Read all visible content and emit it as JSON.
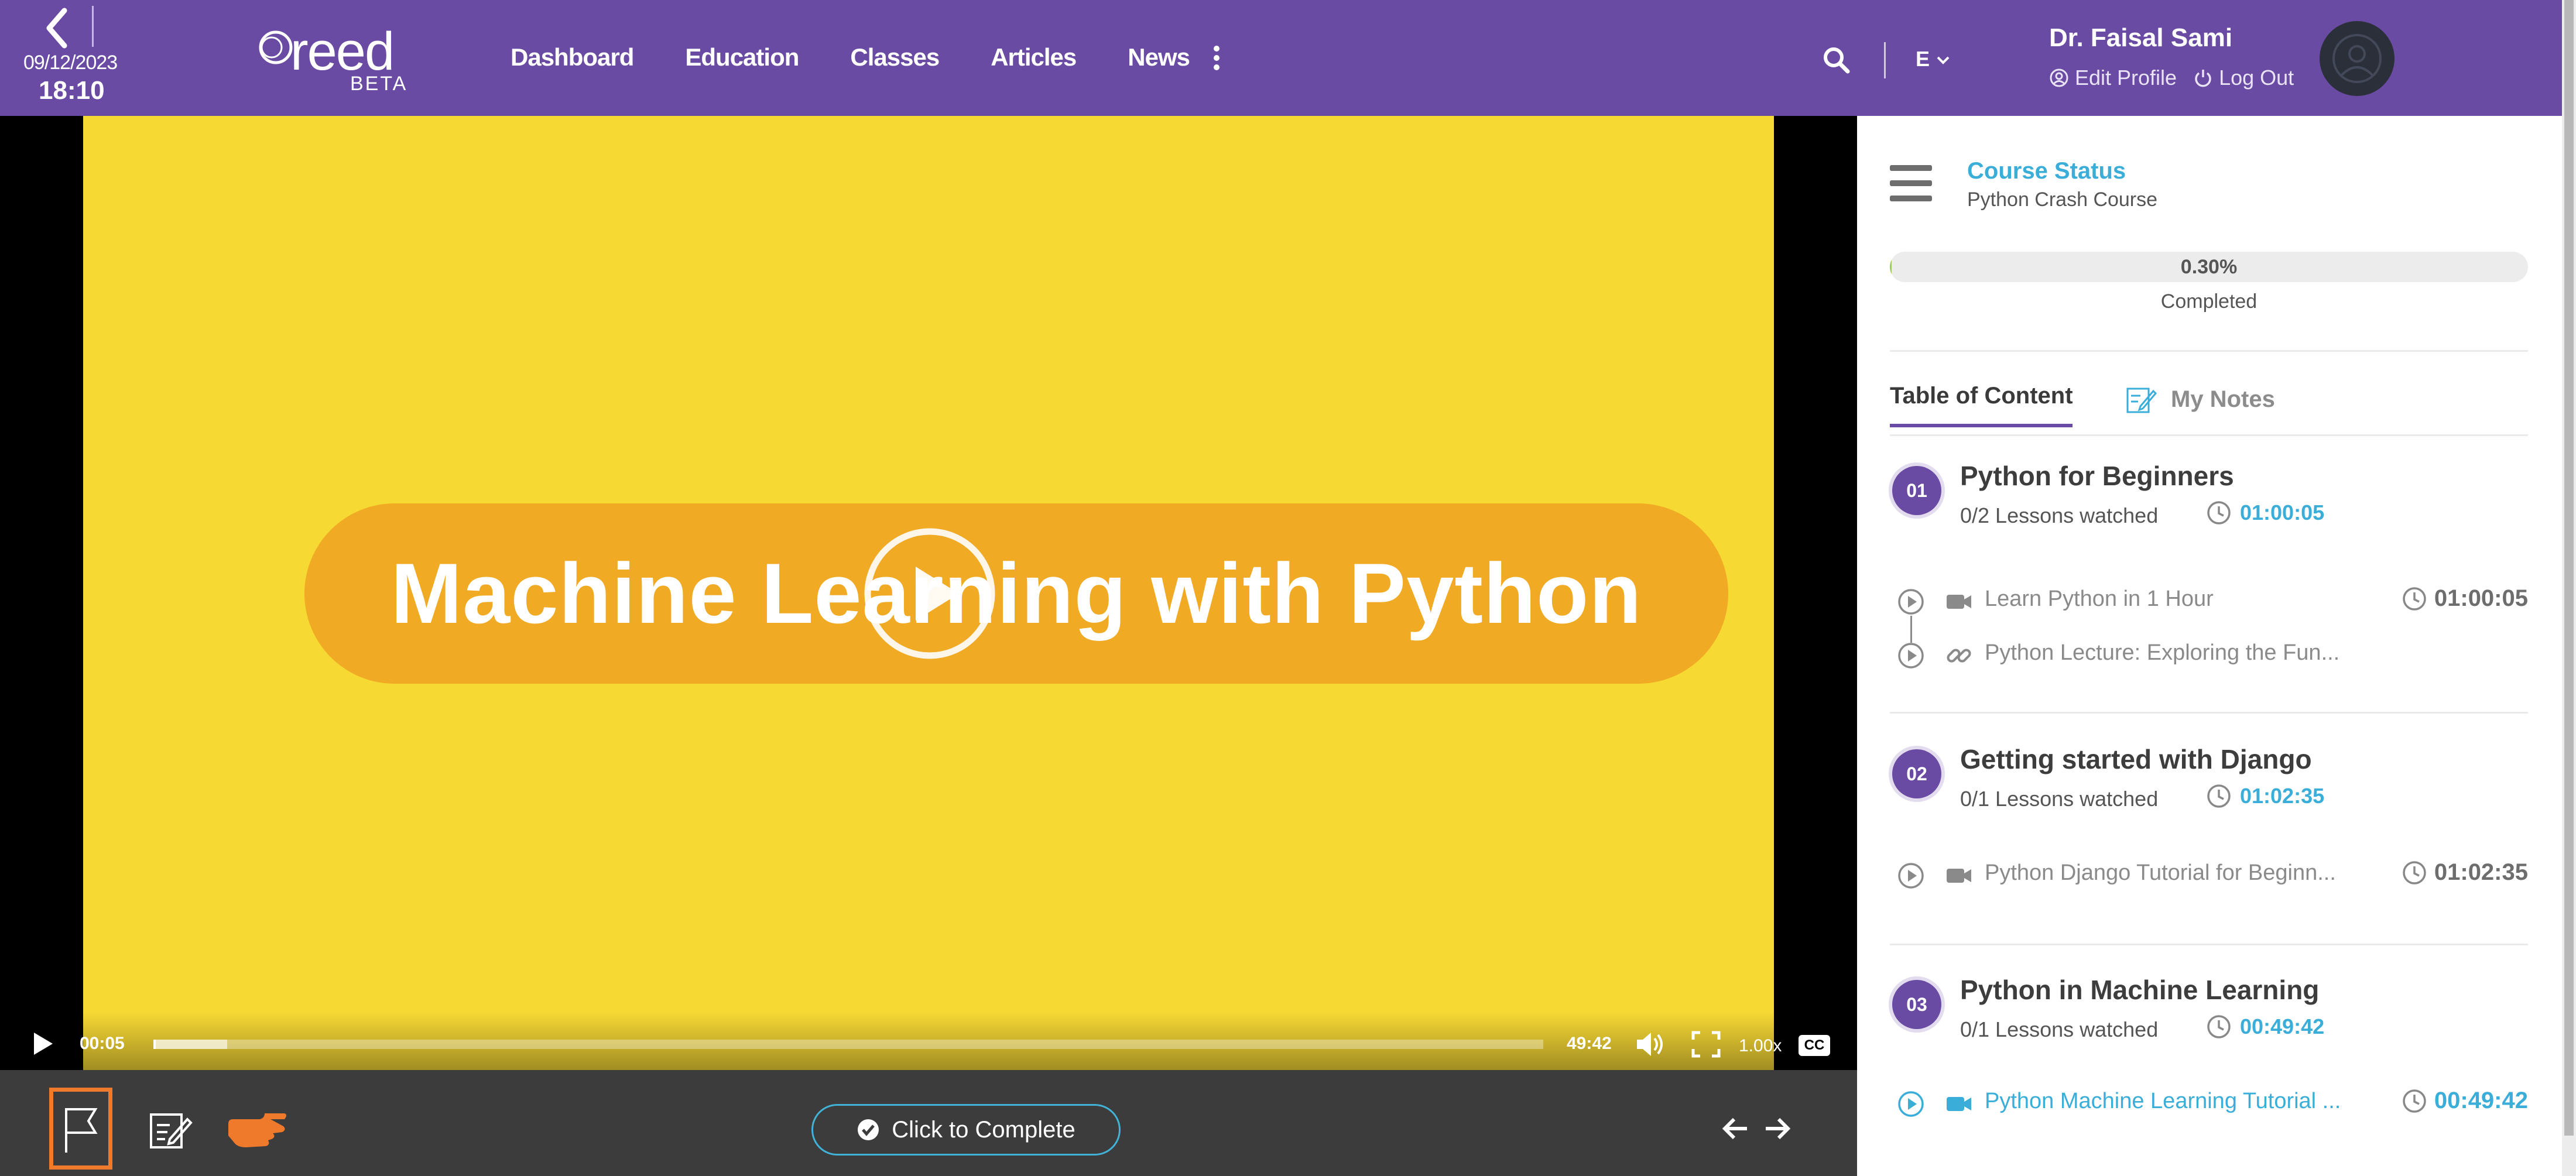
{
  "header": {
    "date": "09/12/2023",
    "time": "18:10",
    "logo_word": "reed",
    "logo_beta": "BETA",
    "nav": [
      "Dashboard",
      "Education",
      "Classes",
      "Articles",
      "News"
    ],
    "language": "E",
    "user_name": "Dr. Faisal Sami",
    "edit_profile": "Edit Profile",
    "log_out": "Log Out"
  },
  "video": {
    "poster_text": "Machine Learning with Python",
    "current_time": "00:05",
    "duration": "49:42",
    "playback_rate": "1.00x",
    "cc_label": "CC",
    "played_fraction": 0.0017,
    "buffered_fraction": 0.053
  },
  "toolbar": {
    "complete_label": "Click to Complete"
  },
  "sidebar": {
    "course_status_title": "Course Status",
    "course_name": "Python Crash Course",
    "progress_percent": 0.3,
    "progress_label": "0.30%",
    "completed_label": "Completed",
    "tabs": {
      "toc": "Table of Content",
      "notes": "My Notes"
    },
    "sections": [
      {
        "number": "01",
        "title": "Python for Beginners",
        "watched": "0/2 Lessons watched",
        "duration": "01:00:05",
        "lessons": [
          {
            "type": "video",
            "title": "Learn Python in 1 Hour",
            "duration": "01:00:05"
          },
          {
            "type": "link",
            "title": "Python Lecture: Exploring the Fun..."
          }
        ]
      },
      {
        "number": "02",
        "title": "Getting started with Django",
        "watched": "0/1 Lessons watched",
        "duration": "01:02:35",
        "lessons": [
          {
            "type": "video",
            "title": "Python Django Tutorial for Beginn...",
            "duration": "01:02:35"
          }
        ]
      },
      {
        "number": "03",
        "title": "Python in Machine Learning",
        "watched": "0/1 Lessons watched",
        "duration": "00:49:42",
        "lessons": [
          {
            "type": "video",
            "title": "Python Machine Learning Tutorial ...",
            "duration": "00:49:42",
            "active": true
          }
        ]
      }
    ]
  },
  "colors": {
    "brand_purple": "#6a4ba3",
    "accent_blue": "#3aaed8",
    "highlight_orange": "#f07a2c",
    "poster_yellow": "#f7d934",
    "banner_orange": "#f0aa24"
  }
}
